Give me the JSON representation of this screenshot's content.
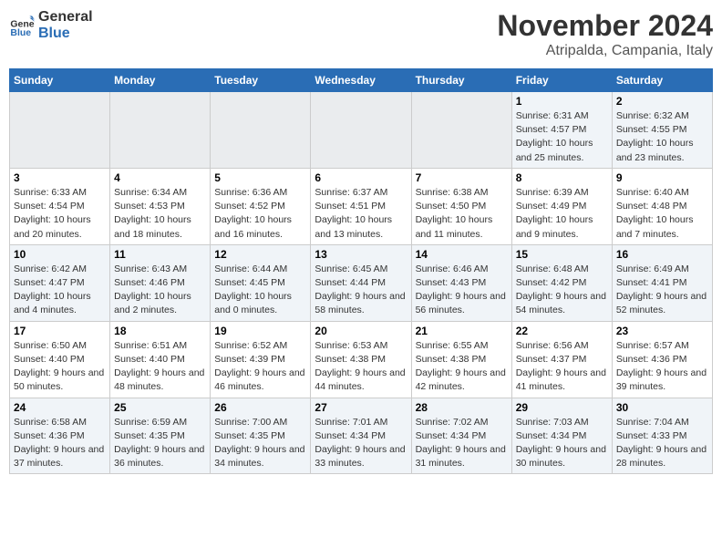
{
  "header": {
    "logo_general": "General",
    "logo_blue": "Blue",
    "month": "November 2024",
    "location": "Atripalda, Campania, Italy"
  },
  "weekdays": [
    "Sunday",
    "Monday",
    "Tuesday",
    "Wednesday",
    "Thursday",
    "Friday",
    "Saturday"
  ],
  "weeks": [
    [
      {
        "day": "",
        "info": ""
      },
      {
        "day": "",
        "info": ""
      },
      {
        "day": "",
        "info": ""
      },
      {
        "day": "",
        "info": ""
      },
      {
        "day": "",
        "info": ""
      },
      {
        "day": "1",
        "info": "Sunrise: 6:31 AM\nSunset: 4:57 PM\nDaylight: 10 hours and 25 minutes."
      },
      {
        "day": "2",
        "info": "Sunrise: 6:32 AM\nSunset: 4:55 PM\nDaylight: 10 hours and 23 minutes."
      }
    ],
    [
      {
        "day": "3",
        "info": "Sunrise: 6:33 AM\nSunset: 4:54 PM\nDaylight: 10 hours and 20 minutes."
      },
      {
        "day": "4",
        "info": "Sunrise: 6:34 AM\nSunset: 4:53 PM\nDaylight: 10 hours and 18 minutes."
      },
      {
        "day": "5",
        "info": "Sunrise: 6:36 AM\nSunset: 4:52 PM\nDaylight: 10 hours and 16 minutes."
      },
      {
        "day": "6",
        "info": "Sunrise: 6:37 AM\nSunset: 4:51 PM\nDaylight: 10 hours and 13 minutes."
      },
      {
        "day": "7",
        "info": "Sunrise: 6:38 AM\nSunset: 4:50 PM\nDaylight: 10 hours and 11 minutes."
      },
      {
        "day": "8",
        "info": "Sunrise: 6:39 AM\nSunset: 4:49 PM\nDaylight: 10 hours and 9 minutes."
      },
      {
        "day": "9",
        "info": "Sunrise: 6:40 AM\nSunset: 4:48 PM\nDaylight: 10 hours and 7 minutes."
      }
    ],
    [
      {
        "day": "10",
        "info": "Sunrise: 6:42 AM\nSunset: 4:47 PM\nDaylight: 10 hours and 4 minutes."
      },
      {
        "day": "11",
        "info": "Sunrise: 6:43 AM\nSunset: 4:46 PM\nDaylight: 10 hours and 2 minutes."
      },
      {
        "day": "12",
        "info": "Sunrise: 6:44 AM\nSunset: 4:45 PM\nDaylight: 10 hours and 0 minutes."
      },
      {
        "day": "13",
        "info": "Sunrise: 6:45 AM\nSunset: 4:44 PM\nDaylight: 9 hours and 58 minutes."
      },
      {
        "day": "14",
        "info": "Sunrise: 6:46 AM\nSunset: 4:43 PM\nDaylight: 9 hours and 56 minutes."
      },
      {
        "day": "15",
        "info": "Sunrise: 6:48 AM\nSunset: 4:42 PM\nDaylight: 9 hours and 54 minutes."
      },
      {
        "day": "16",
        "info": "Sunrise: 6:49 AM\nSunset: 4:41 PM\nDaylight: 9 hours and 52 minutes."
      }
    ],
    [
      {
        "day": "17",
        "info": "Sunrise: 6:50 AM\nSunset: 4:40 PM\nDaylight: 9 hours and 50 minutes."
      },
      {
        "day": "18",
        "info": "Sunrise: 6:51 AM\nSunset: 4:40 PM\nDaylight: 9 hours and 48 minutes."
      },
      {
        "day": "19",
        "info": "Sunrise: 6:52 AM\nSunset: 4:39 PM\nDaylight: 9 hours and 46 minutes."
      },
      {
        "day": "20",
        "info": "Sunrise: 6:53 AM\nSunset: 4:38 PM\nDaylight: 9 hours and 44 minutes."
      },
      {
        "day": "21",
        "info": "Sunrise: 6:55 AM\nSunset: 4:38 PM\nDaylight: 9 hours and 42 minutes."
      },
      {
        "day": "22",
        "info": "Sunrise: 6:56 AM\nSunset: 4:37 PM\nDaylight: 9 hours and 41 minutes."
      },
      {
        "day": "23",
        "info": "Sunrise: 6:57 AM\nSunset: 4:36 PM\nDaylight: 9 hours and 39 minutes."
      }
    ],
    [
      {
        "day": "24",
        "info": "Sunrise: 6:58 AM\nSunset: 4:36 PM\nDaylight: 9 hours and 37 minutes."
      },
      {
        "day": "25",
        "info": "Sunrise: 6:59 AM\nSunset: 4:35 PM\nDaylight: 9 hours and 36 minutes."
      },
      {
        "day": "26",
        "info": "Sunrise: 7:00 AM\nSunset: 4:35 PM\nDaylight: 9 hours and 34 minutes."
      },
      {
        "day": "27",
        "info": "Sunrise: 7:01 AM\nSunset: 4:34 PM\nDaylight: 9 hours and 33 minutes."
      },
      {
        "day": "28",
        "info": "Sunrise: 7:02 AM\nSunset: 4:34 PM\nDaylight: 9 hours and 31 minutes."
      },
      {
        "day": "29",
        "info": "Sunrise: 7:03 AM\nSunset: 4:34 PM\nDaylight: 9 hours and 30 minutes."
      },
      {
        "day": "30",
        "info": "Sunrise: 7:04 AM\nSunset: 4:33 PM\nDaylight: 9 hours and 28 minutes."
      }
    ]
  ]
}
